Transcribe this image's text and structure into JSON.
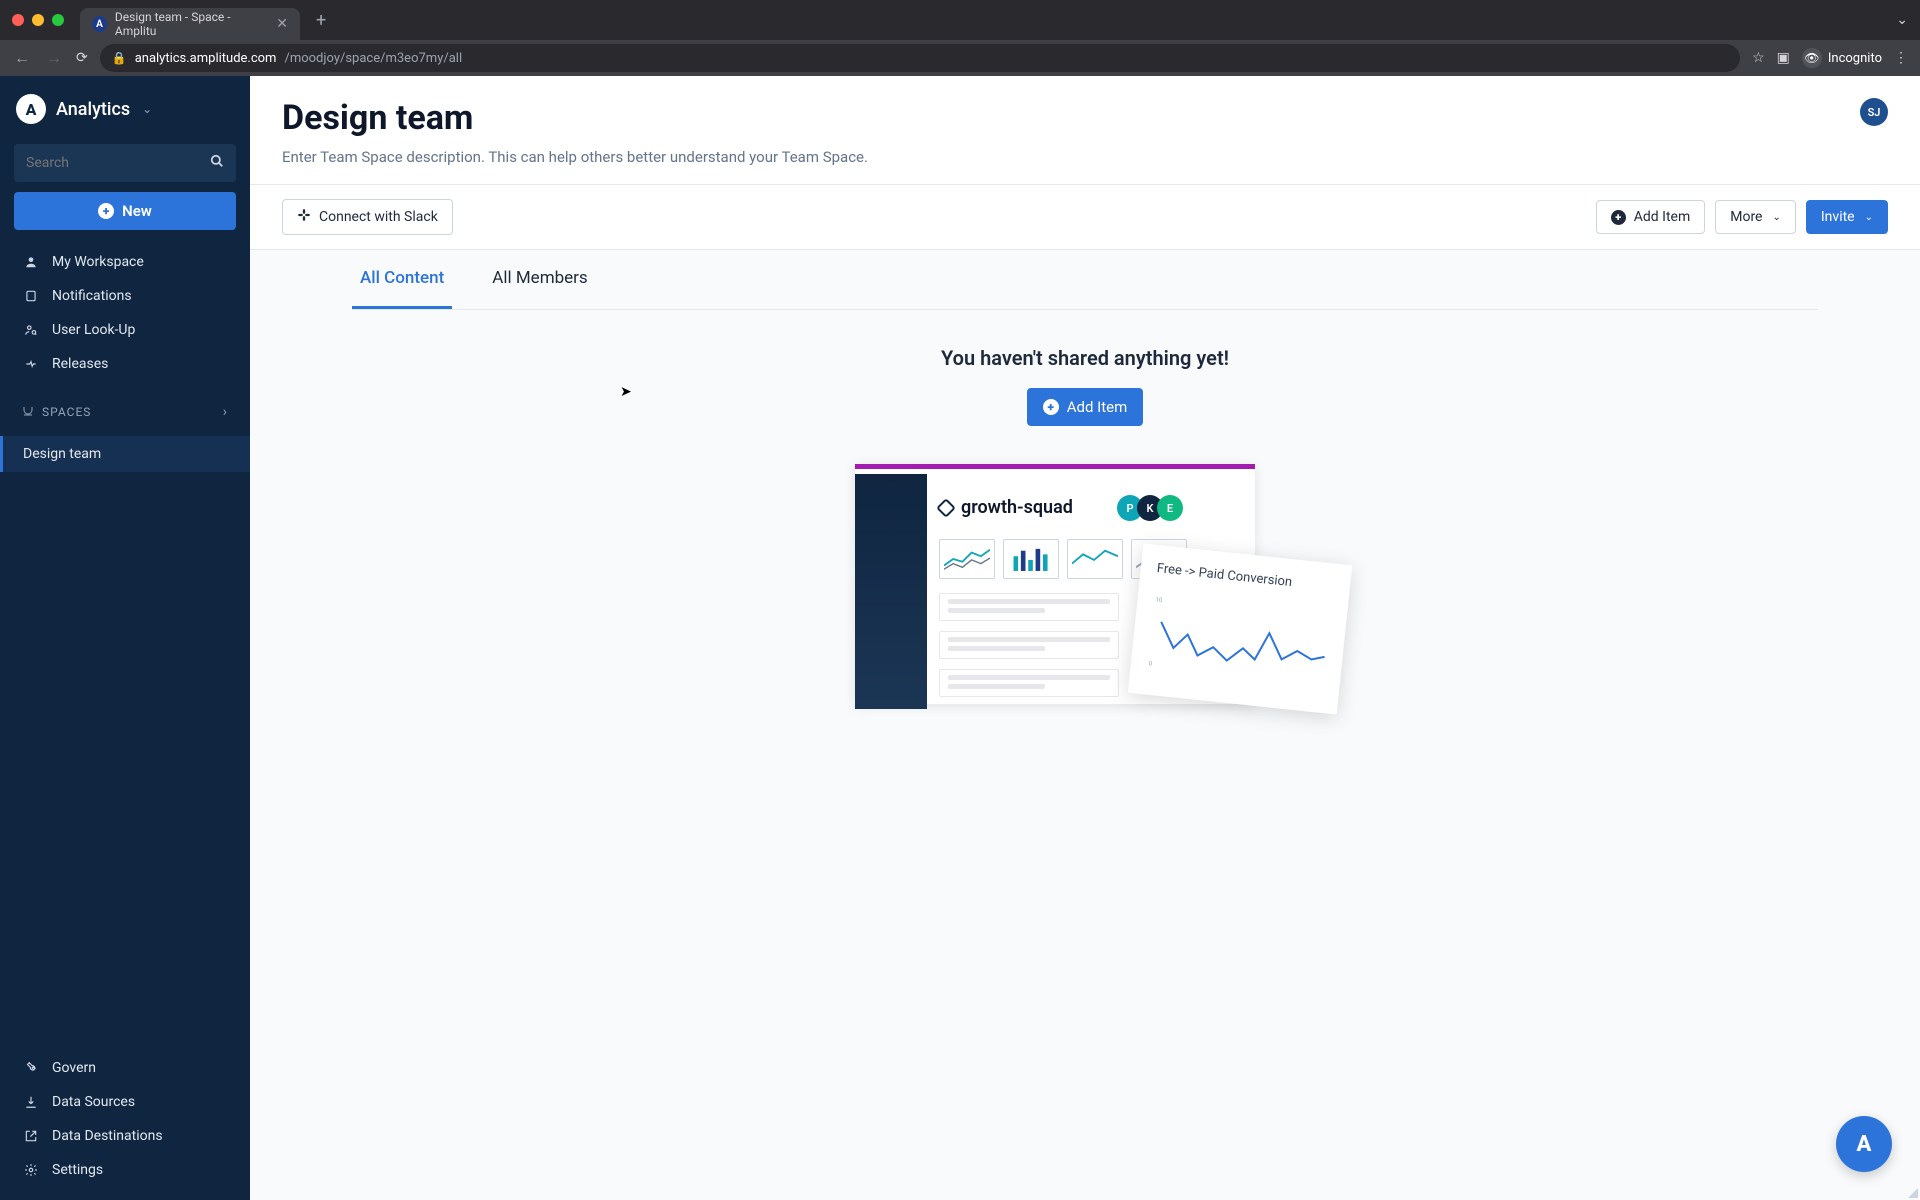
{
  "browser": {
    "tab_title": "Design team - Space - Amplitu",
    "url_host": "analytics.amplitude.com",
    "url_path": "/moodjoy/space/m3eo7my/all",
    "incognito_label": "Incognito"
  },
  "sidebar": {
    "brand": "Analytics",
    "search_placeholder": "Search",
    "new_button": "New",
    "nav": [
      {
        "label": "My Workspace",
        "icon": "person"
      },
      {
        "label": "Notifications",
        "icon": "bell"
      },
      {
        "label": "User Look-Up",
        "icon": "user-lookup"
      },
      {
        "label": "Releases",
        "icon": "releases"
      }
    ],
    "spaces_heading": "SPACES",
    "spaces": [
      {
        "label": "Design team",
        "active": true
      }
    ],
    "bottom": [
      {
        "label": "Govern",
        "icon": "wrench"
      },
      {
        "label": "Data Sources",
        "icon": "download"
      },
      {
        "label": "Data Destinations",
        "icon": "share"
      },
      {
        "label": "Settings",
        "icon": "gear"
      }
    ]
  },
  "page": {
    "title": "Design team",
    "description": "Enter Team Space description. This can help others better understand your Team Space.",
    "avatar_initials": "SJ"
  },
  "actions": {
    "slack": "Connect with Slack",
    "add_item": "Add Item",
    "more": "More",
    "invite": "Invite"
  },
  "tabs": {
    "all_content": "All Content",
    "all_members": "All Members"
  },
  "empty": {
    "heading": "You haven't shared anything yet!",
    "add_item": "Add Item"
  },
  "illustration": {
    "space_name": "growth-squad",
    "avatars": [
      "P",
      "K",
      "E"
    ],
    "popup_title": "Free -> Paid Conversion"
  },
  "colors": {
    "accent": "#2d74da",
    "sidebar_bg": "#0f2540",
    "illustration_accent": "#a21caf"
  }
}
